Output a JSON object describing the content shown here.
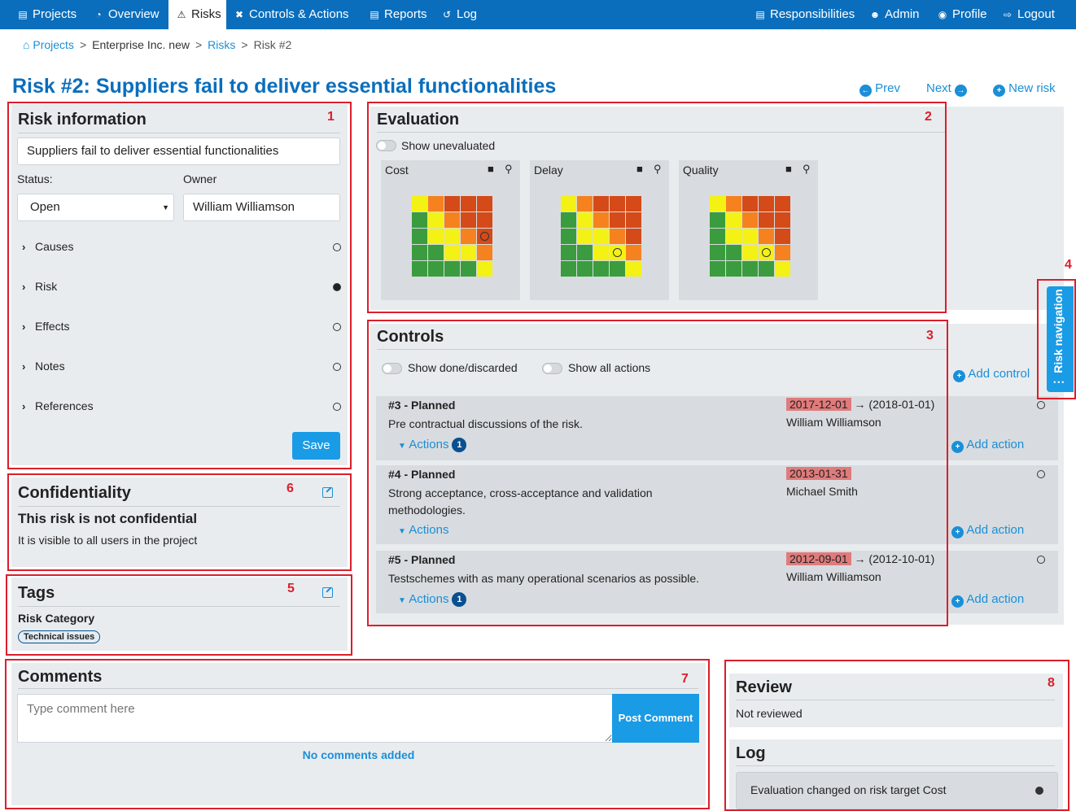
{
  "nav": {
    "left": [
      {
        "label": "Projects",
        "icon": "sitemap-icon"
      },
      {
        "label": "Overview",
        "icon": "pie-chart-icon"
      },
      {
        "label": "Risks",
        "icon": "warning-icon",
        "active": true
      },
      {
        "label": "Controls & Actions",
        "icon": "tools-icon"
      },
      {
        "label": "Reports",
        "icon": "file-icon"
      },
      {
        "label": "Log",
        "icon": "history-icon"
      }
    ],
    "right": [
      {
        "label": "Responsibilities",
        "icon": "clipboard-icon"
      },
      {
        "label": "Admin",
        "icon": "user-cog-icon"
      },
      {
        "label": "Profile",
        "icon": "user-circle-icon"
      },
      {
        "label": "Logout",
        "icon": "sign-out-icon"
      }
    ]
  },
  "breadcrumb": {
    "projects": "Projects",
    "project": "Enterprise Inc. new",
    "risks": "Risks",
    "current": "Risk #2",
    "separator": ">"
  },
  "page": {
    "title": "Risk #2: Suppliers fail to deliver essential functionalities",
    "prev": "Prev",
    "next": "Next",
    "new_risk": "New risk"
  },
  "risk_info": {
    "title": "Risk information",
    "name_value": "Suppliers fail to deliver essential functionalities",
    "status_label": "Status:",
    "status_value": "Open",
    "owner_label": "Owner",
    "owner_value": "William Williamson",
    "sections": [
      {
        "label": "Causes",
        "filled": false
      },
      {
        "label": "Risk",
        "filled": true
      },
      {
        "label": "Effects",
        "filled": false
      },
      {
        "label": "Notes",
        "filled": false
      },
      {
        "label": "References",
        "filled": false
      }
    ],
    "save": "Save"
  },
  "confidentiality": {
    "title": "Confidentiality",
    "status": "This risk is not confidential",
    "description": "It is visible to all users in the project"
  },
  "tags": {
    "title": "Tags",
    "category": "Risk Category",
    "tag": "Technical issues"
  },
  "evaluation": {
    "title": "Evaluation",
    "show_unevaluated": "Show unevaluated",
    "matrix_colors": [
      [
        "y",
        "o",
        "r",
        "r",
        "r"
      ],
      [
        "g",
        "y",
        "o",
        "r",
        "r"
      ],
      [
        "g",
        "y",
        "y",
        "o",
        "r"
      ],
      [
        "g",
        "g",
        "y",
        "y",
        "o"
      ],
      [
        "g",
        "g",
        "g",
        "g",
        "y"
      ]
    ],
    "color_map": {
      "g": "#3a9c3e",
      "y": "#f4f115",
      "o": "#f5821f",
      "r": "#d44a18"
    },
    "targets": [
      {
        "name": "Cost",
        "marker_row": 2,
        "marker_col": 4
      },
      {
        "name": "Delay",
        "marker_row": 3,
        "marker_col": 3
      },
      {
        "name": "Quality",
        "marker_row": 3,
        "marker_col": 3
      }
    ]
  },
  "controls": {
    "title": "Controls",
    "show_done": "Show done/discarded",
    "show_all_actions": "Show all actions",
    "add_control": "Add control",
    "items": [
      {
        "title": "#3 - Planned",
        "description": "Pre contractual discussions of the risk.",
        "due": "2017-12-01",
        "arrow": "→",
        "new_date": "(2018-01-01)",
        "owner": "William Williamson",
        "actions_label": "Actions",
        "actions_count": "1",
        "add_action": "Add action"
      },
      {
        "title": "#4 - Planned",
        "description": "Strong acceptance, cross-acceptance and validation methodologies.",
        "due": "2013-01-31",
        "arrow": "",
        "new_date": "",
        "owner": "Michael Smith",
        "actions_label": "Actions",
        "actions_count": "",
        "add_action": "Add action"
      },
      {
        "title": "#5 - Planned",
        "description": "Testschemes with as many operational scenarios as possible.",
        "due": "2012-09-01",
        "arrow": "→",
        "new_date": "(2012-10-01)",
        "owner": "William Williamson",
        "actions_label": "Actions",
        "actions_count": "1",
        "add_action": "Add action"
      }
    ]
  },
  "risk_navigation": {
    "label": "Risk navigation"
  },
  "comments": {
    "title": "Comments",
    "placeholder": "Type comment here",
    "post": "Post Comment",
    "empty": "No comments added"
  },
  "review": {
    "title": "Review",
    "status": "Not reviewed"
  },
  "log": {
    "title": "Log",
    "entries": [
      "Evaluation changed on risk target Cost"
    ]
  },
  "annotations": [
    "1",
    "2",
    "3",
    "4",
    "5",
    "6",
    "7",
    "8"
  ]
}
